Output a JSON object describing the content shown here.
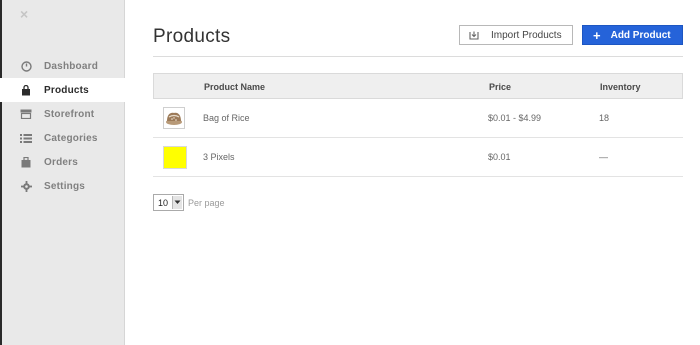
{
  "sidebar": {
    "close_icon": "×",
    "items": [
      {
        "label": "Dashboard",
        "icon": "dashboard-icon"
      },
      {
        "label": "Products",
        "icon": "bag-icon",
        "active": true
      },
      {
        "label": "Storefront",
        "icon": "storefront-icon"
      },
      {
        "label": "Categories",
        "icon": "list-icon"
      },
      {
        "label": "Orders",
        "icon": "orders-icon"
      },
      {
        "label": "Settings",
        "icon": "gear-icon"
      }
    ]
  },
  "header": {
    "title": "Products",
    "import_label": "Import Products",
    "add_label": "Add Product",
    "add_plus": "+",
    "accent_color": "#2563d9"
  },
  "table": {
    "columns": [
      "Product Name",
      "Price",
      "Inventory"
    ],
    "rows": [
      {
        "name": "Bag of Rice",
        "price": "$0.01 - $4.99",
        "inventory": "18",
        "thumb": "rice-bag-image"
      },
      {
        "name": "3 Pixels",
        "price": "$0.01",
        "inventory": "—",
        "thumb": "yellow-swatch",
        "thumb_color": "#ffff00"
      }
    ]
  },
  "pager": {
    "per_page_value": "10",
    "per_page_label": "Per page"
  }
}
